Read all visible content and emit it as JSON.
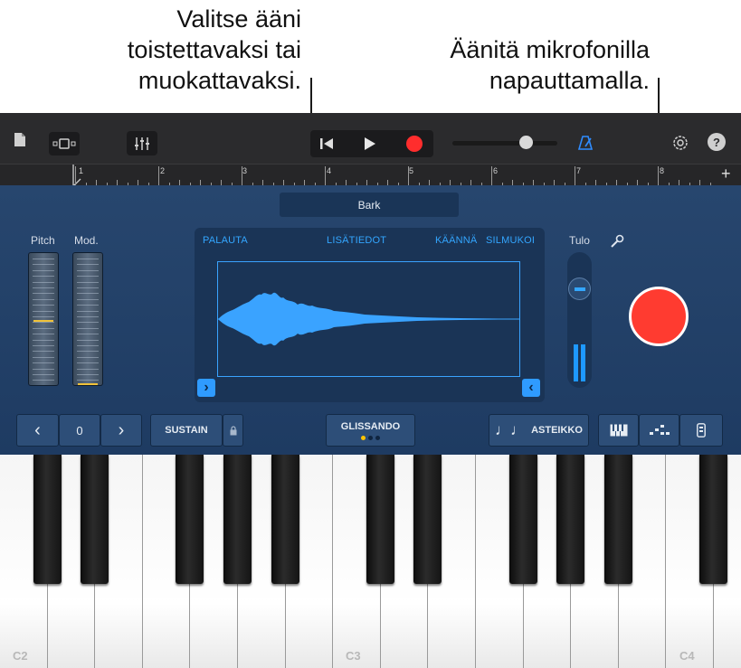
{
  "callouts": {
    "left_line1": "Valitse ääni",
    "left_line2": "toistettavaksi tai",
    "left_line3": "muokattavaksi.",
    "right_line1": "Äänitä mikrofonilla",
    "right_line2": "napauttamalla."
  },
  "ruler": {
    "bars": [
      "1",
      "2",
      "3",
      "4",
      "5",
      "6",
      "7",
      "8"
    ],
    "add_symbol": "+"
  },
  "sound": {
    "name": "Bark"
  },
  "wheels": {
    "pitch_label": "Pitch",
    "mod_label": "Mod."
  },
  "wave": {
    "options": [
      "PALAUTA",
      "LISÄTIEDOT",
      "KÄÄNNÄ",
      "SILMUKOI"
    ],
    "trim_left": "›",
    "trim_right": "‹"
  },
  "input": {
    "label": "Tulo",
    "level": 0.3
  },
  "octave": {
    "down": "‹",
    "value": "0",
    "up": "›"
  },
  "buttons": {
    "sustain": "SUSTAIN",
    "glissando": "GLISSANDO",
    "scale_note": "♩♩",
    "scale": "ASTEIKKO"
  },
  "keyboard": {
    "labels": [
      "C2",
      "C3",
      "C4"
    ]
  },
  "colors": {
    "accent": "#33a6ff",
    "record": "#ff3b30",
    "panel": "#22416a",
    "toolbar": "#2b2b2d"
  }
}
